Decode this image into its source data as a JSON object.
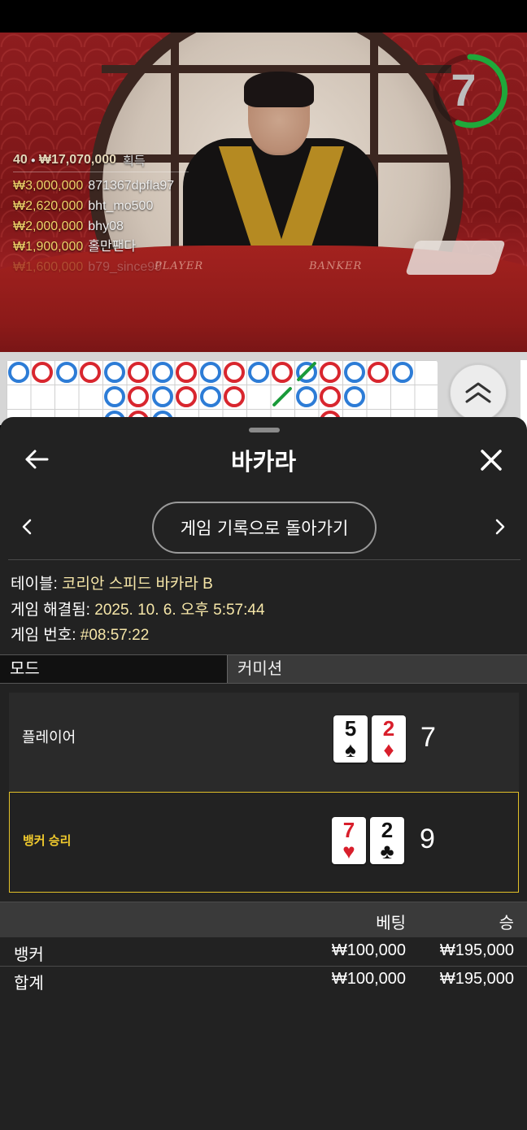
{
  "video": {
    "timer_value": "7",
    "table_labels": {
      "player": "PLAYER",
      "banker": "BANKER"
    },
    "winners": {
      "count": "40",
      "total": "₩17,070,000",
      "total_suffix": "획득",
      "rows": [
        {
          "amount": "₩3,000,000",
          "name": "871367dpfla97"
        },
        {
          "amount": "₩2,620,000",
          "name": "bht_mo500"
        },
        {
          "amount": "₩2,000,000",
          "name": "bhy08"
        },
        {
          "amount": "₩1,900,000",
          "name": "홀만팬다"
        },
        {
          "amount": "₩1,600,000",
          "name": "b79_since99"
        }
      ]
    }
  },
  "sheet": {
    "title": "바카라",
    "back_to_history": "게임 기록으로 돌아가기",
    "info": {
      "table_label": "테이블:",
      "table_value": "코리안 스피드 바카라 B",
      "resolved_label": "게임 해결됨:",
      "resolved_value": "2025. 10. 6. 오후 5:57:44",
      "number_label": "게임 번호:",
      "number_value": "#08:57:22"
    },
    "tabs": {
      "mode": "모드",
      "commission": "커미션"
    },
    "player": {
      "label": "플레이어",
      "cards": [
        {
          "rank": "5",
          "suit": "♠"
        },
        {
          "rank": "2",
          "suit": "♦"
        }
      ],
      "total": "7"
    },
    "banker": {
      "label": "뱅커 승리",
      "cards": [
        {
          "rank": "7",
          "suit": "♥"
        },
        {
          "rank": "2",
          "suit": "♣"
        }
      ],
      "total": "9"
    },
    "bets": {
      "col_bet": "베팅",
      "col_win": "승",
      "rows": [
        {
          "name": "뱅커",
          "bet": "₩100,000",
          "win": "₩195,000"
        },
        {
          "name": "합계",
          "bet": "₩100,000",
          "win": "₩195,000"
        }
      ]
    }
  },
  "colors": {
    "banker_red": "#d8262e",
    "player_blue": "#2d7cd6",
    "tie_green": "#1a9a3a",
    "win_gold": "#e2c028",
    "timer_green": "#1fa83a"
  },
  "icons": {
    "back": "arrow-left-icon",
    "close": "close-icon",
    "prev": "chevron-left-icon",
    "next": "chevron-right-icon",
    "scroll_up": "double-chevron-up-icon"
  }
}
